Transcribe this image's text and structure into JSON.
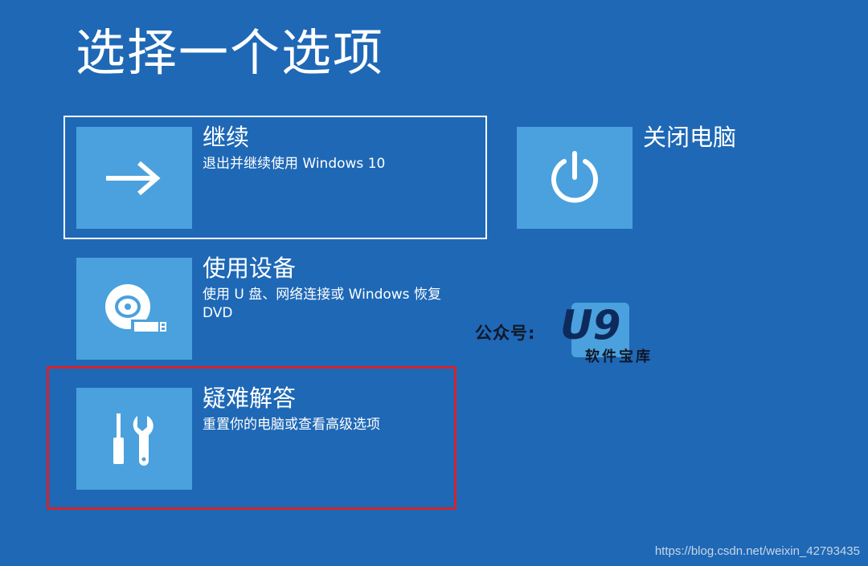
{
  "page": {
    "title": "选择一个选项"
  },
  "options": {
    "continue": {
      "title": "继续",
      "desc": "退出并继续使用 Windows 10",
      "icon": "arrow-right-icon"
    },
    "shutdown": {
      "title": "关闭电脑",
      "icon": "power-icon"
    },
    "use_device": {
      "title": "使用设备",
      "desc": "使用 U 盘、网络连接或 Windows 恢复 DVD",
      "icon": "disc-usb-icon"
    },
    "troubleshoot": {
      "title": "疑难解答",
      "desc": "重置你的电脑或查看高级选项",
      "icon": "tools-icon"
    }
  },
  "watermark": {
    "label": "公众号:",
    "logo": "U9",
    "sub": "软件宝库",
    "url": "https://blog.csdn.net/weixin_42793435"
  },
  "colors": {
    "background": "#1e68b6",
    "tile": "#4aa1dd",
    "text": "#ffffff",
    "highlight": "#d4232a"
  }
}
